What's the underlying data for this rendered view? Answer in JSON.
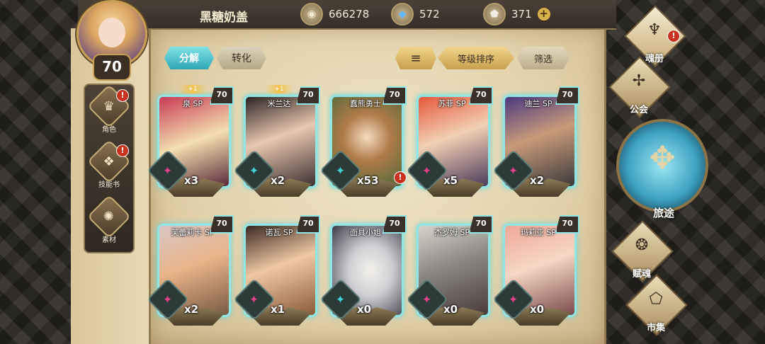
{
  "player": {
    "name": "黑糖奶盖",
    "level": "70"
  },
  "currencies": [
    {
      "icon": "gold-coin-icon",
      "value": "666278"
    },
    {
      "icon": "blue-crystal-icon",
      "value": "572"
    },
    {
      "icon": "white-gem-icon",
      "value": "371",
      "plus": "+"
    }
  ],
  "side_nav": [
    {
      "label": "角色",
      "icon": "character-icon"
    },
    {
      "label": "技能书",
      "icon": "skill-book-icon"
    },
    {
      "label": "素材",
      "icon": "material-icon"
    }
  ],
  "tabs": {
    "decompose": "分解",
    "convert": "转化"
  },
  "sort": {
    "level_sort": "等级排序",
    "filter": "筛选"
  },
  "cards": [
    {
      "name": "泉 SP",
      "level": "70",
      "plus": "+1",
      "count": "x3",
      "emblem_color": "#e0408a"
    },
    {
      "name": "米兰达",
      "level": "70",
      "plus": "+1",
      "count": "x2",
      "emblem_color": "#3fd0d6"
    },
    {
      "name": "蠢熊勇士",
      "level": "70",
      "plus": "",
      "count": "x53",
      "emblem_color": "#3fd0d6"
    },
    {
      "name": "苏菲 SP",
      "level": "70",
      "plus": "",
      "count": "x5",
      "emblem_color": "#e0408a"
    },
    {
      "name": "迪兰 SP",
      "level": "70",
      "plus": "",
      "count": "x2",
      "emblem_color": "#e0408a"
    },
    {
      "name": "芙蕾莉卡 SP",
      "level": "70",
      "plus": "",
      "count": "x2",
      "emblem_color": "#e0408a"
    },
    {
      "name": "诺瓦 SP",
      "level": "70",
      "plus": "",
      "count": "x1",
      "emblem_color": "#e0408a"
    },
    {
      "name": "面具小姐",
      "level": "70",
      "plus": "",
      "count": "x0",
      "emblem_color": "#3fd0d6"
    },
    {
      "name": "杰罗姆 SP",
      "level": "70",
      "plus": "",
      "count": "x0",
      "emblem_color": "#e0408a"
    },
    {
      "name": "玛莉亚 SP",
      "level": "70",
      "plus": "",
      "count": "x0",
      "emblem_color": "#e0408a"
    }
  ],
  "right_nav": {
    "soul_book": "魂册",
    "guild": "公会",
    "journey": "旅途",
    "endow": "赋魂",
    "market": "市集"
  },
  "alert_mark": "!",
  "colors": {
    "teal": "#8fe6e4",
    "gold": "#c8a04e"
  }
}
